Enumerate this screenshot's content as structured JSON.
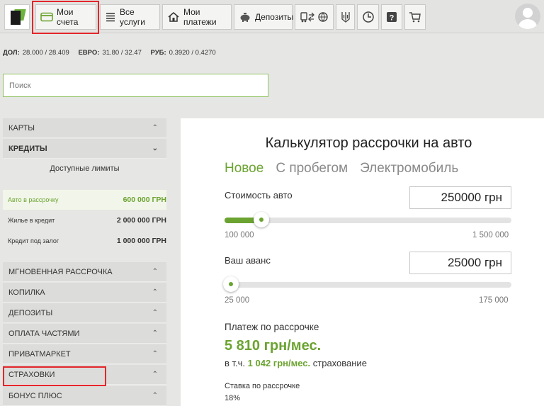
{
  "nav": {
    "items": [
      {
        "label": "Мои счета",
        "icon": "card-icon"
      },
      {
        "label": "Все услуги",
        "icon": "list-icon"
      },
      {
        "label": "Мои платежи",
        "icon": "house-icon"
      },
      {
        "label": "Депозиты",
        "icon": "piggy-bank-icon"
      }
    ],
    "highlight_color": "#e3262b"
  },
  "rates": {
    "usd_label": "ДОЛ:",
    "usd_value": "28.000 / 28.409",
    "eur_label": "ЕВРО:",
    "eur_value": "31.80 / 32.47",
    "rub_label": "РУБ:",
    "rub_value": "0.3920 / 0.4270"
  },
  "search": {
    "placeholder": "Поиск"
  },
  "sidebar": {
    "cards": "КАРТЫ",
    "credits": "КРЕДИТЫ",
    "limits_title": "Доступные лимиты",
    "limits": [
      {
        "label": "Авто в рассрочку",
        "amount": "600 000 ГРН"
      },
      {
        "label": "Жилье в кредит",
        "amount": "2 000 000 ГРН"
      },
      {
        "label": "Кредит под залог",
        "amount": "1 000 000 ГРН"
      }
    ],
    "items": [
      "МГНОВЕННАЯ РАССРОЧКА",
      "КОПИЛКА",
      "ДЕПОЗИТЫ",
      "ОПЛАТА ЧАСТЯМИ",
      "ПРИВАТМАРКЕТ",
      "СТРАХОВКИ",
      "БОНУС ПЛЮС"
    ]
  },
  "calculator": {
    "title": "Калькулятор рассрочки на авто",
    "tabs": [
      "Новое",
      "С пробегом",
      "Электромобиль"
    ],
    "price_label": "Стоимость авто",
    "price_value": "250000 грн",
    "price_min": "100 000",
    "price_max": "1 500 000",
    "price_fraction": 0.107,
    "advance_label": "Ваш аванс",
    "advance_value": "25000 грн",
    "advance_min": "25 000",
    "advance_max": "175 000",
    "advance_fraction": 0.0,
    "payment_label": "Платеж по рассрочке",
    "payment_value": "5 810 грн/мес.",
    "insurance_prefix": "в т.ч.",
    "insurance_value": "1 042 грн/мес.",
    "insurance_suffix": "страхование",
    "rate_label": "Ставка по рассрочке",
    "rate_value": "18%",
    "accent_color": "#6ba330"
  }
}
